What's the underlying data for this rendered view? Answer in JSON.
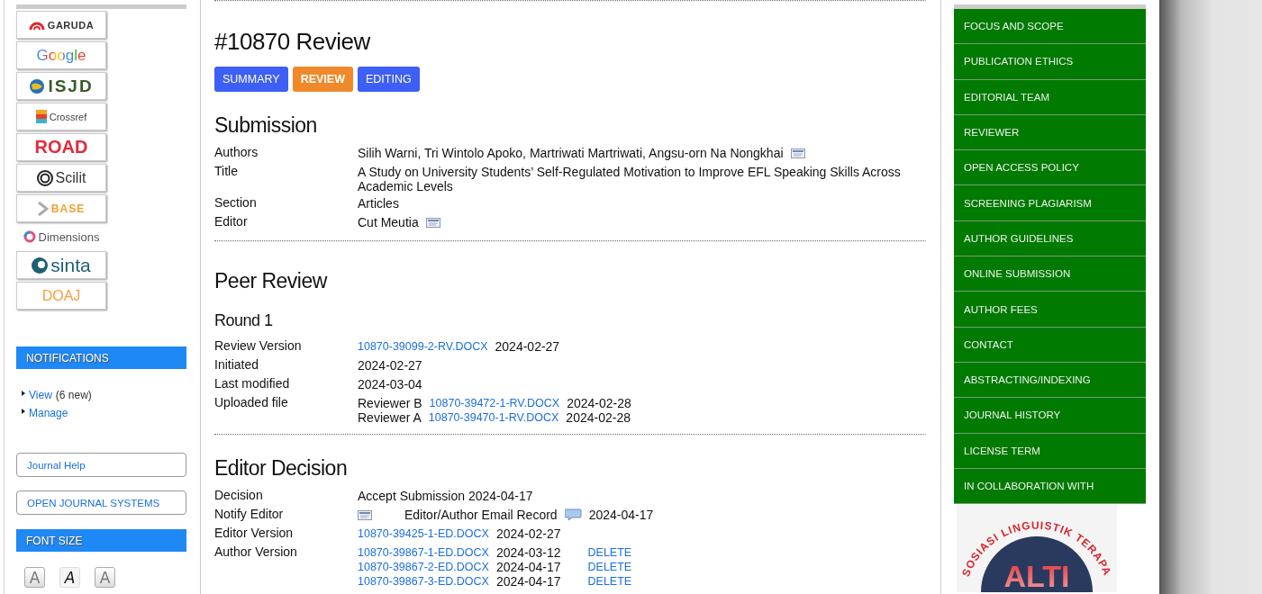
{
  "left_sidebar": {
    "logos": [
      {
        "kind": "garuda",
        "text": "GARUDA"
      },
      {
        "kind": "google",
        "text": "Google"
      },
      {
        "kind": "isjd",
        "text": "ISJD"
      },
      {
        "kind": "crossref",
        "text": "Crossref"
      },
      {
        "kind": "road",
        "text": "ROAD"
      },
      {
        "kind": "scilit",
        "text": "Scilit"
      },
      {
        "kind": "base",
        "text": "BASE"
      },
      {
        "kind": "dimensions",
        "text": "Dimensions"
      },
      {
        "kind": "sinta",
        "text": "sinta"
      },
      {
        "kind": "doaj",
        "text": "DOAJ"
      }
    ],
    "notifications": {
      "title": "NOTIFICATIONS",
      "links": [
        {
          "label": "View",
          "note": "(6 new)"
        },
        {
          "label": "Manage"
        }
      ]
    },
    "boxed_links": [
      "Journal Help",
      "OPEN JOURNAL SYSTEMS"
    ],
    "font_size": {
      "title": "FONT SIZE",
      "buttons": [
        {
          "kind": "decrease",
          "label": "A"
        },
        {
          "kind": "default",
          "label": "A"
        },
        {
          "kind": "increase",
          "label": "A"
        }
      ]
    }
  },
  "main": {
    "title": "#10870 Review",
    "tabs": [
      {
        "label": "SUMMARY",
        "selected": false
      },
      {
        "label": "REVIEW",
        "selected": true
      },
      {
        "label": "EDITING",
        "selected": false
      }
    ],
    "sections": [
      {
        "heading": "Submission",
        "kind": "section",
        "rows": [
          {
            "label": "Authors",
            "lines": [
              [
                {
                  "kind": "text",
                  "text": "Silih Warni, Tri Wintolo Apoko, Martriwati Martriwati, Angsu-orn Na Nongkhai"
                },
                {
                  "kind": "mail"
                }
              ]
            ]
          },
          {
            "label": "Title",
            "lines": [
              [
                {
                  "kind": "text",
                  "text": "A Study on University Students’ Self-Regulated Motivation to Improve EFL Speaking Skills Across Academic Levels"
                }
              ]
            ]
          },
          {
            "label": "Section",
            "lines": [
              [
                {
                  "kind": "text",
                  "text": "Articles"
                }
              ]
            ]
          },
          {
            "label": "Editor",
            "lines": [
              [
                {
                  "kind": "text",
                  "text": "Cut Meutia"
                },
                {
                  "kind": "mail"
                }
              ]
            ]
          }
        ],
        "divider": true
      },
      {
        "heading": "Peer Review",
        "kind": "section"
      },
      {
        "heading": "Round 1",
        "kind": "subsection",
        "rows": [
          {
            "label": "Review Version",
            "lines": [
              [
                {
                  "kind": "link",
                  "text": "10870-39099-2-RV.DOCX"
                },
                {
                  "kind": "text",
                  "text": "2024-02-27"
                }
              ]
            ]
          },
          {
            "label": "Initiated",
            "lines": [
              [
                {
                  "kind": "text",
                  "text": "2024-02-27"
                }
              ]
            ]
          },
          {
            "label": "Last modified",
            "lines": [
              [
                {
                  "kind": "text",
                  "text": "2024-03-04"
                }
              ]
            ]
          },
          {
            "label": "Uploaded file",
            "lines": [
              [
                {
                  "kind": "text",
                  "text": "Reviewer B"
                },
                {
                  "kind": "link",
                  "text": "10870-39472-1-RV.DOCX"
                },
                {
                  "kind": "text",
                  "text": "2024-02-28"
                }
              ],
              [
                {
                  "kind": "text",
                  "text": "Reviewer A"
                },
                {
                  "kind": "link",
                  "text": "10870-39470-1-RV.DOCX"
                },
                {
                  "kind": "text",
                  "text": "2024-02-28"
                }
              ]
            ]
          }
        ],
        "divider": true
      },
      {
        "heading": "Editor Decision",
        "kind": "section",
        "rows": [
          {
            "label": "Decision",
            "lines": [
              [
                {
                  "kind": "text",
                  "text": "Accept Submission 2024-04-17"
                }
              ]
            ]
          },
          {
            "label": "Notify Editor",
            "lines": [
              [
                {
                  "kind": "mail"
                },
                {
                  "kind": "text",
                  "text": "Editor/Author Email Record"
                },
                {
                  "kind": "comment"
                },
                {
                  "kind": "text",
                  "text": "2024-04-17"
                }
              ]
            ]
          },
          {
            "label": "Editor Version",
            "lines": [
              [
                {
                  "kind": "link",
                  "text": "10870-39425-1-ED.DOCX"
                },
                {
                  "kind": "text",
                  "text": "2024-02-27"
                }
              ]
            ]
          },
          {
            "label": "Author Version",
            "lines": [
              [
                {
                  "kind": "link",
                  "text": "10870-39867-1-ED.DOCX"
                },
                {
                  "kind": "text",
                  "text": "2024-03-12"
                },
                {
                  "kind": "action",
                  "text": "DELETE"
                }
              ],
              [
                {
                  "kind": "link",
                  "text": "10870-39867-2-ED.DOCX"
                },
                {
                  "kind": "text",
                  "text": "2024-04-17"
                },
                {
                  "kind": "action",
                  "text": "DELETE"
                }
              ],
              [
                {
                  "kind": "link",
                  "text": "10870-39867-3-ED.DOCX"
                },
                {
                  "kind": "text",
                  "text": "2024-04-17"
                },
                {
                  "kind": "action",
                  "text": "DELETE"
                }
              ]
            ]
          }
        ]
      }
    ]
  },
  "right_sidebar": {
    "menu": [
      "FOCUS AND SCOPE",
      "PUBLICATION ETHICS",
      "EDITORIAL TEAM",
      "REVIEWER",
      "OPEN ACCESS POLICY",
      "SCREENING PLAGIARISM",
      "AUTHOR GUIDELINES",
      "ONLINE SUBMISSION",
      "AUTHOR FEES",
      "CONTACT",
      "ABSTRACTING/INDEXING",
      "JOURNAL HISTORY",
      "LICENSE TERM",
      "IN COLLABORATION WITH"
    ],
    "association_logo": {
      "arc_text": "SOSIASI LINGUISTIK TERAPA",
      "initials": "ALTI"
    }
  }
}
